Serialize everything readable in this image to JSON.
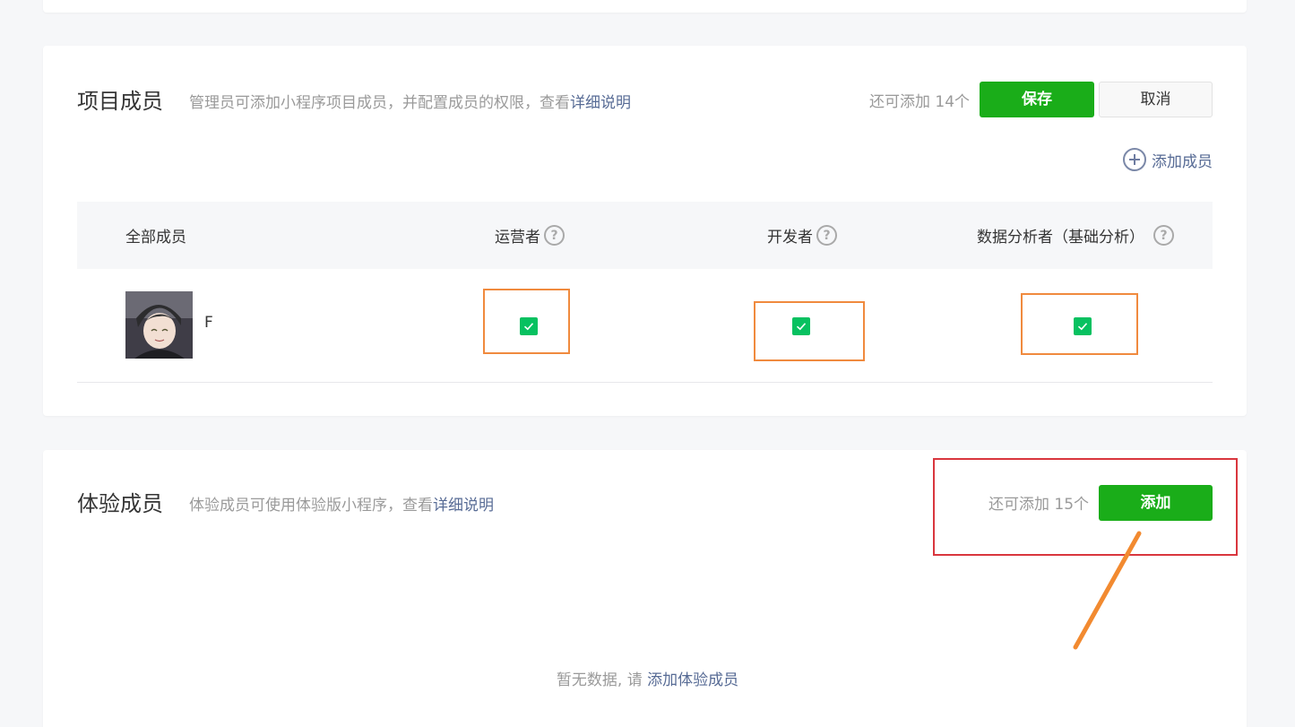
{
  "members_section": {
    "title": "项目成员",
    "description": "管理员可添加小程序项目成员，并配置成员的权限，查看",
    "detail_link": "详细说明",
    "quota": "还可添加 14个",
    "save_label": "保存",
    "cancel_label": "取消",
    "add_member_label": "添加成员",
    "columns": [
      "全部成员",
      "运营者",
      "开发者",
      "数据分析者（基础分析）"
    ],
    "rows": [
      {
        "name": "F",
        "operator": true,
        "developer": true,
        "analyst": true
      }
    ]
  },
  "experience_section": {
    "title": "体验成员",
    "description": "体验成员可使用体验版小程序，查看",
    "detail_link": "详细说明",
    "quota": "还可添加 15个",
    "add_label": "添加",
    "empty_text": "暂无数据, 请",
    "empty_link": "添加体验成员"
  },
  "colors": {
    "primary_green": "#1aad19",
    "checkbox_green": "#07c160",
    "link_blue": "#576b95",
    "highlight_orange": "#f08a3e",
    "highlight_red": "#d9363e"
  }
}
